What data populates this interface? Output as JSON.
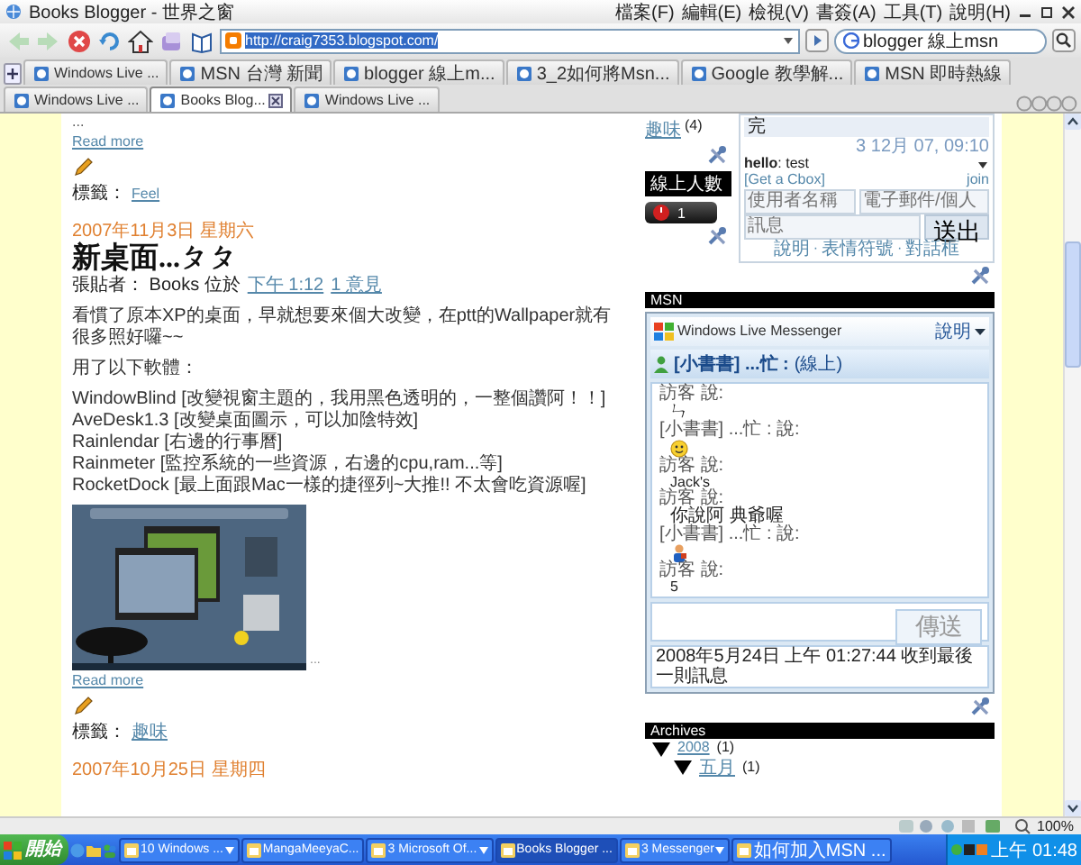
{
  "window": {
    "title": "Books Blogger - 世界之窗",
    "menu": [
      "檔案(F)",
      "編輯(E)",
      "檢視(V)",
      "書簽(A)",
      "工具(T)",
      "說明(H)"
    ]
  },
  "address_bar": {
    "value": "http://craig7353.blogspot.com/",
    "highlighted": true
  },
  "search": {
    "value": "blogger 線上msn"
  },
  "tabs": [
    {
      "label": "Windows Live ...",
      "selected": false
    },
    {
      "label": "MSN 台灣 新聞",
      "selected": false
    },
    {
      "label": "blogger 線上m...",
      "selected": false
    },
    {
      "label": "3_2如何將Msn...",
      "selected": false
    },
    {
      "label": "Google 教學解...",
      "selected": false
    },
    {
      "label": "MSN 即時熱線",
      "selected": false
    },
    {
      "label": "Windows Live ...",
      "selected": false
    },
    {
      "label": "Books Blog...",
      "selected": true
    },
    {
      "label": "Windows Live ...",
      "selected": false
    }
  ],
  "posts": [
    {
      "ellipsis": "...",
      "read_more": "Read more",
      "labels_caption": "標籤：",
      "labels": [
        "Feel"
      ]
    },
    {
      "date": "2007年11月3日 星期六",
      "title": "新桌面...ㄆㄆ",
      "byline": "張貼者： Books 位於",
      "time": "下午 1:12",
      "comments": "1 意見",
      "paragraphs": [
        [
          "看慣了原本XP的桌面，早就想要來個大改變，在ptt的Wallpaper就有很多照好囉~~"
        ],
        [
          "用了以下軟體："
        ],
        [
          "WindowBlind [改變視窗主題的，我用黑色透明的，一整個讚阿！！]",
          "AveDesk1.3 [改變桌面圖示，可以加陰特效]",
          "Rainlendar [右邊的行事曆]",
          "Rainmeter [監控系統的一些資源，右邊的cpu,ram...等]",
          "RocketDock [最上面跟Mac一樣的捷徑列~大推!! 不太會吃資源喔]"
        ]
      ],
      "has_image": true,
      "ellipsis": "...",
      "read_more": "Read more",
      "labels_caption": "標籤：",
      "labels": [
        "趣味"
      ]
    },
    {
      "date": "2007年10月25日 星期四"
    }
  ],
  "sidebar": {
    "label_link": "趣味",
    "label_count": "(4)",
    "online": {
      "title": "線上人數",
      "count": "1"
    },
    "cbox": {
      "partial_message": "完",
      "timestamp": "3 12月 07, 09:10",
      "message": "**hello**: test",
      "get_link": "[Get a Cbox]",
      "join_link": "join",
      "name_placeholder": "使用者名稱",
      "email_placeholder": "電子郵件/個人",
      "message_placeholder": "訊息",
      "submit": "送出",
      "separator": "·",
      "footer_links": [
        "說明",
        "表情符號",
        "對話框"
      ]
    },
    "msn": {
      "title": "MSN",
      "logo": "Windows Live Messenger",
      "help": "說明",
      "status_name": "[小書書] ...忙 :",
      "status": "(線上)",
      "chat": [
        {
          "kind": "text",
          "sender": "訪客 說:",
          "text": "ㄣ"
        },
        {
          "kind": "smiley",
          "sender": "[小書書] ...忙 : 說:"
        },
        {
          "kind": "text",
          "sender": "訪客 說:",
          "text": "Jack's"
        },
        {
          "kind": "text",
          "sender": "訪客 說:",
          "text": "你說阿 典爺喔"
        },
        {
          "kind": "figure",
          "sender": "[小書書] ...忙 : 說:"
        },
        {
          "kind": "text",
          "sender": "訪客 說:",
          "text": "5"
        }
      ],
      "send": "傳送",
      "footer": "2008年5月24日 上午 01:27:44 收到最後一則訊息"
    },
    "archives": {
      "title": "Archives",
      "tree": [
        {
          "label": "2008",
          "count": "(1)",
          "expanded": true,
          "children": [
            {
              "label": "五月",
              "count": "(1)",
              "expanded": true
            }
          ]
        }
      ]
    }
  },
  "status_bar": {
    "zoom": "100%"
  },
  "taskbar": {
    "start": "開始",
    "tasks": [
      {
        "label": "10 Windows ...",
        "grouped": true,
        "selected": false
      },
      {
        "label": "MangaMeeyaC...",
        "grouped": false,
        "selected": false
      },
      {
        "label": "3 Microsoft Of...",
        "grouped": true,
        "selected": false
      },
      {
        "label": "Books Blogger ...",
        "grouped": false,
        "selected": true
      },
      {
        "label": "3 Messenger",
        "grouped": true,
        "selected": false
      },
      {
        "label": "如何加入MSN ...",
        "grouped": false,
        "selected": false
      }
    ],
    "clock": "上午 01:48"
  }
}
